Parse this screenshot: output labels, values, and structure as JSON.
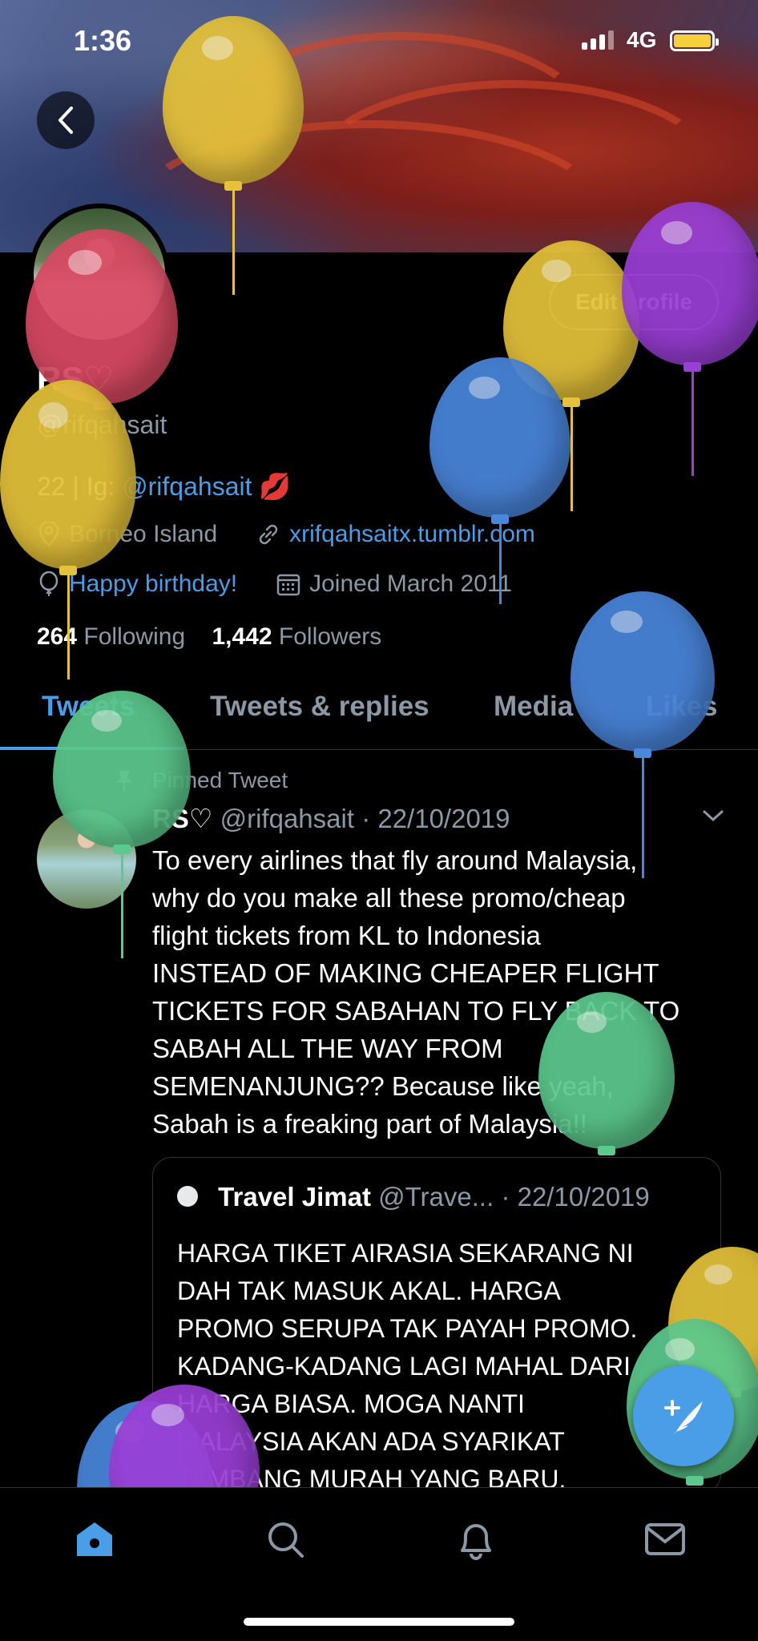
{
  "status_bar": {
    "time": "1:36",
    "network": "4G"
  },
  "profile": {
    "edit_label": "Edit profile",
    "name": "RS♡",
    "handle": "@rifqahsait",
    "bio_prefix": "22 | Ig: ",
    "bio_link": "@rifqahsait",
    "bio_emoji": "💋",
    "location": "Borneo Island",
    "website": "xrifqahsaitx.tumblr.com",
    "birthday": "Happy birthday!",
    "joined": "Joined March 2011",
    "following_count": "264",
    "following_label": "Following",
    "followers_count": "1,442",
    "followers_label": "Followers"
  },
  "tabs": [
    {
      "label": "Tweets"
    },
    {
      "label": "Tweets & replies"
    },
    {
      "label": "Media"
    },
    {
      "label": "Likes"
    }
  ],
  "pinned_tweet": {
    "pinned_label": "Pinned Tweet",
    "name": "RS♡",
    "handle": "@rifqahsait",
    "date": "· 22/10/2019",
    "text": "To every airlines that fly around Malaysia,\nwhy do you make all these promo/cheap\nflight tickets from KL to Indonesia\nINSTEAD OF MAKING CHEAPER FLIGHT\nTICKETS FOR SABAHAN TO FLY BACK TO\nSABAH ALL THE WAY FROM\nSEMENANJUNG?? Because like yeah,\nSabah is a freaking part of Malaysia!!",
    "quote": {
      "name": "Travel Jimat",
      "handle": "@Trave...",
      "date": "· 22/10/2019",
      "text": "HARGA TIKET AIRASIA SEKARANG NI\nDAH TAK MASUK AKAL. HARGA\nPROMO SERUPA TAK PAYAH PROMO.\nKADANG-KADANG LAGI MAHAL DARI\nHARGA BIASA. MOGA NANTI\nMALAYSIA AKAN ADA SYARIKAT\nTAMBANG MURAH YANG BARU."
    }
  },
  "bottom_nav": [
    {
      "icon": "home-icon",
      "active": true
    },
    {
      "icon": "search-icon",
      "active": false
    },
    {
      "icon": "bell-icon",
      "active": false
    },
    {
      "icon": "mail-icon",
      "active": false
    }
  ],
  "colors": {
    "accent": "#4a9ee8",
    "muted": "#8b98a5",
    "background": "#000000",
    "balloon_yellow": "#e5c23a",
    "balloon_red": "#d94a63",
    "balloon_purple": "#9a3fd6",
    "balloon_blue": "#4a86dc",
    "balloon_green": "#5cc98d"
  }
}
